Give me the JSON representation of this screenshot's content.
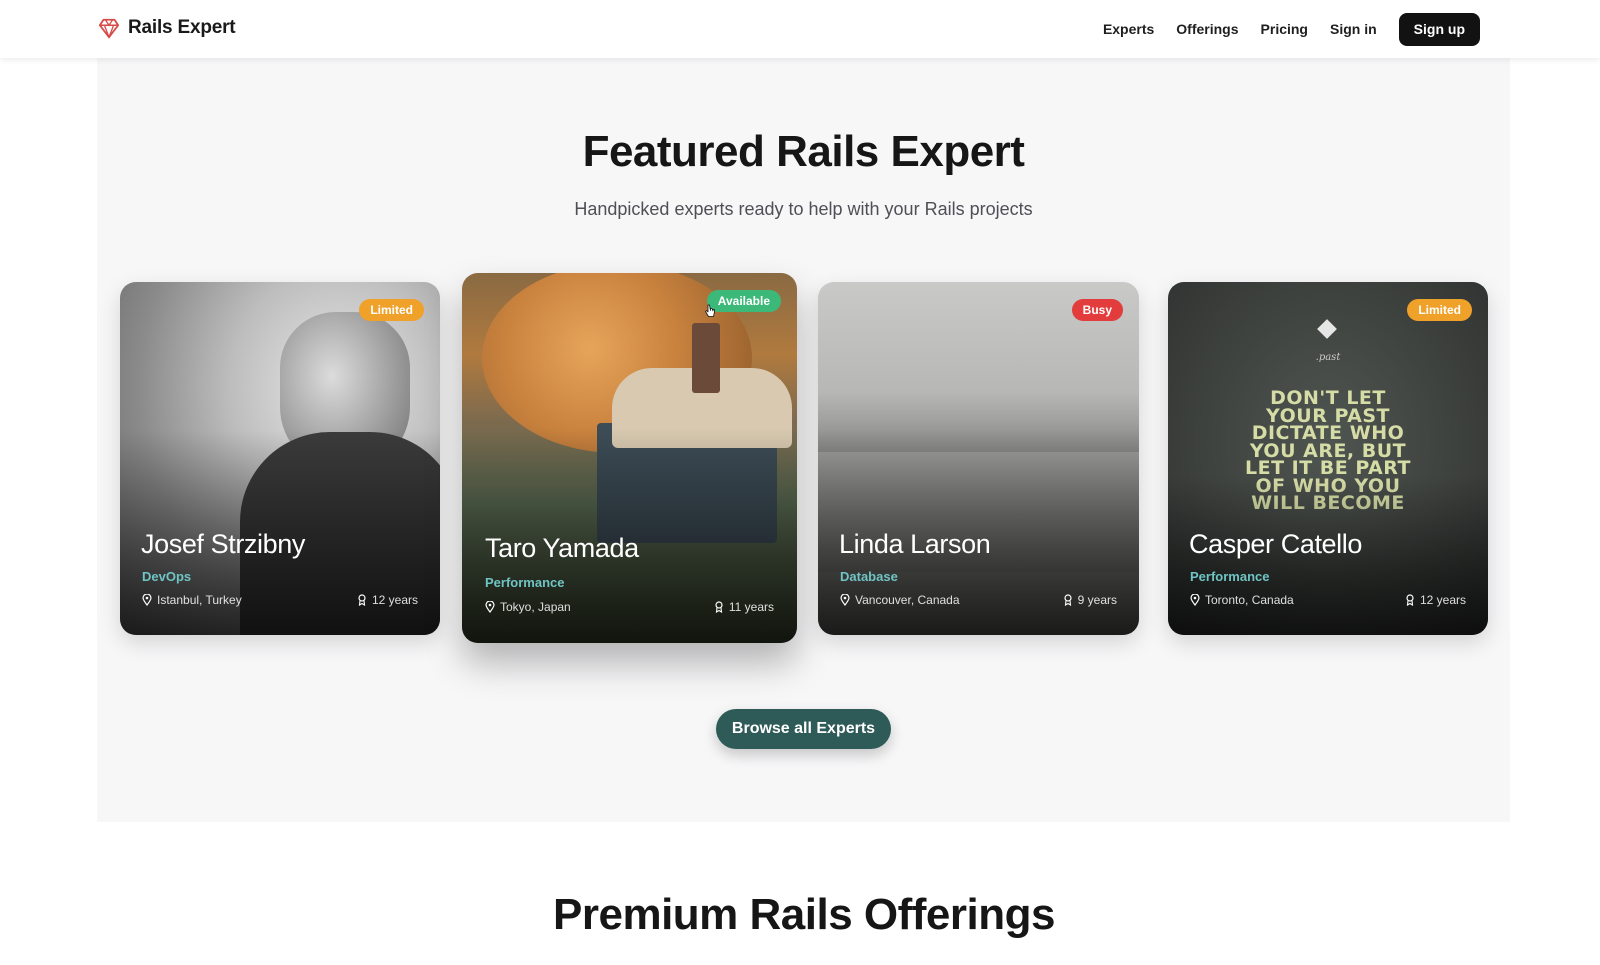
{
  "header": {
    "brand": "Rails Expert",
    "nav": [
      "Experts",
      "Offerings",
      "Pricing",
      "Sign in"
    ],
    "signup_label": "Sign up",
    "brand_color": "#d64b47"
  },
  "featured": {
    "title": "Featured Rails Expert",
    "subtitle": "Handpicked experts ready to help with your Rails projects",
    "experts": [
      {
        "name": "Josef Strzibny",
        "specialty": "DevOps",
        "location": "Istanbul, Turkey",
        "experience": "12 years",
        "status": "Limited",
        "status_color": "#f0a12a"
      },
      {
        "name": "Taro Yamada",
        "specialty": "Performance",
        "location": "Tokyo, Japan",
        "experience": "11 years",
        "status": "Available",
        "status_color": "#3cb878"
      },
      {
        "name": "Linda Larson",
        "specialty": "Database",
        "location": "Vancouver, Canada",
        "experience": "9 years",
        "status": "Busy",
        "status_color": "#e23c3c"
      },
      {
        "name": "Casper Catello",
        "specialty": "Performance",
        "location": "Toronto, Canada",
        "experience": "12 years",
        "status": "Limited",
        "status_color": "#f0a12a"
      }
    ],
    "card4_quote": "DON'T LET YOUR PAST DICTATE WHO YOU ARE, BUT LET IT BE PART OF WHO YOU WILL BECOME",
    "card4_small": ".past",
    "browse_label": "Browse all Experts",
    "button_color": "#2e5a58"
  },
  "premium": {
    "title": "Premium Rails Offerings"
  }
}
